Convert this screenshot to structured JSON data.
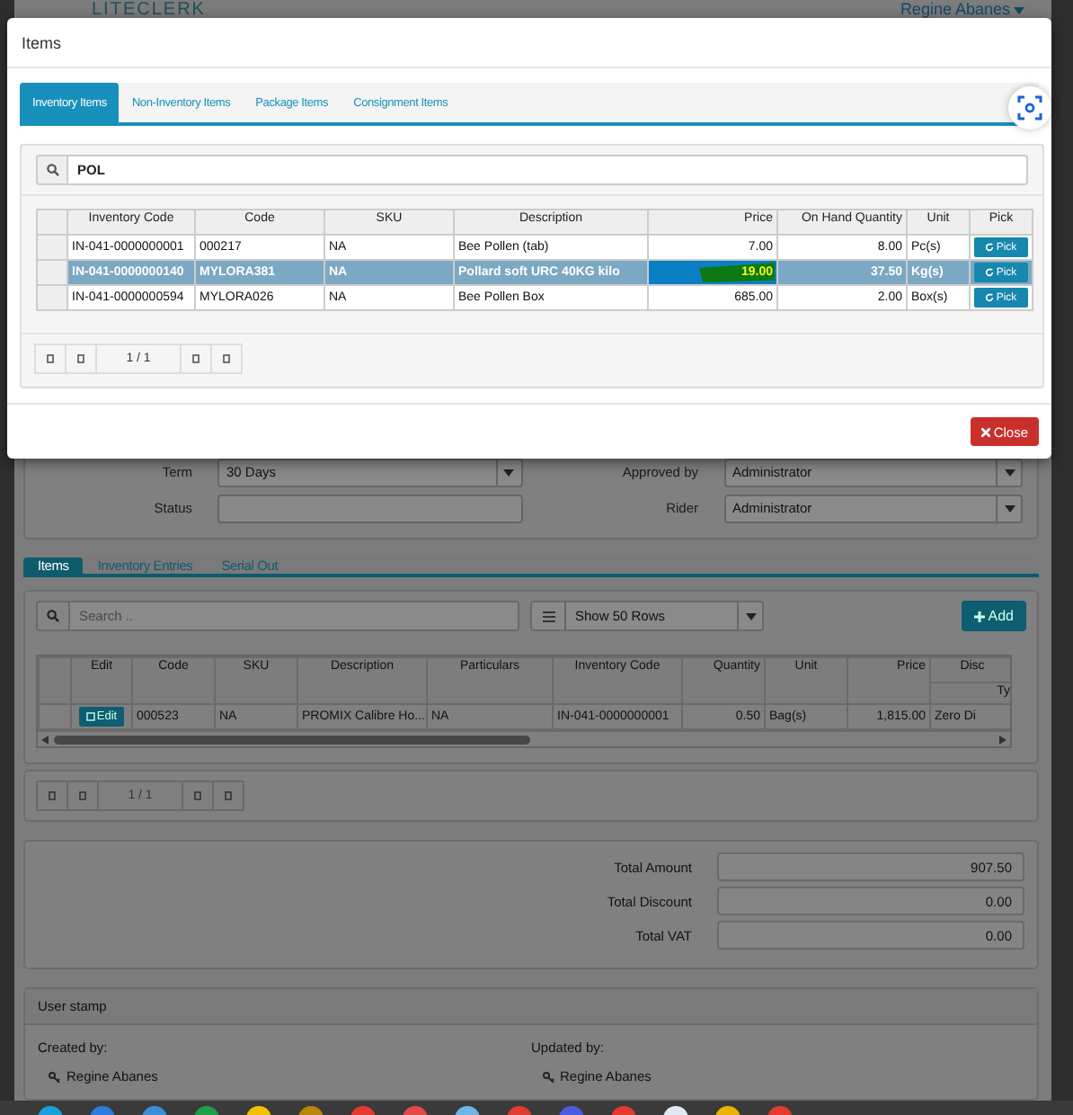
{
  "header": {
    "logo": "LITECLERK",
    "user": "Regine Abanes"
  },
  "form": {
    "fields": [
      {
        "label": "Term",
        "value": "30 Days",
        "kind": "select"
      },
      {
        "label": "Approved by",
        "value": "Administrator",
        "kind": "select"
      },
      {
        "label": "Status",
        "kind": "text"
      },
      {
        "label": "Rider",
        "value": "Administrator",
        "kind": "select"
      }
    ]
  },
  "tabs": [
    {
      "label": "Items",
      "selected": true
    },
    {
      "label": "Inventory Entries",
      "selected": false
    },
    {
      "label": "Serial Out",
      "selected": false
    }
  ],
  "toolbar": {
    "search": {
      "placeholder": "Search .."
    },
    "rows_select": "Show 50 Rows",
    "add_button": "Add"
  },
  "items_table": {
    "columns": [
      "Edit",
      "Code",
      "SKU",
      "Description",
      "Particulars",
      "Inventory Code",
      "Quantity",
      "Unit",
      "Price",
      "Disc"
    ],
    "subheader": "Ty",
    "rows": [
      {
        "cells": [
          "Edit",
          "000523",
          "NA",
          "PROMIX Calibre Ho...",
          "NA",
          "IN-041-0000000001",
          "0.50",
          "Bag(s)",
          "1,815.00",
          "Zero Di"
        ]
      }
    ]
  },
  "items_pager": {
    "page": "1 / 1"
  },
  "totals": [
    {
      "label": "Total Amount",
      "value": "907.50"
    },
    {
      "label": "Total Discount",
      "value": "0.00"
    },
    {
      "label": "Total VAT",
      "value": "0.00"
    }
  ],
  "user_stamp": {
    "title": "User stamp",
    "created_label": "Created by:",
    "created_by": "Regine Abanes",
    "updated_label": "Updated by:",
    "updated_by": "Regine Abanes"
  },
  "modal": {
    "title": "Items",
    "tabs": [
      {
        "label": "Inventory Items",
        "selected": true
      },
      {
        "label": "Non-Inventory Items",
        "selected": false
      },
      {
        "label": "Package Items",
        "selected": false
      },
      {
        "label": "Consignment Items",
        "selected": false
      }
    ],
    "search": {
      "value": "POL"
    },
    "table": {
      "columns": [
        "Inventory Code",
        "Code",
        "SKU",
        "Description",
        "Price",
        "On Hand Quantity",
        "Unit",
        "Pick"
      ],
      "rows": [
        {
          "selected": false,
          "marked": false,
          "cells": [
            "IN-041-0000000001",
            "000217",
            "NA",
            "Bee Pollen (tab)",
            "7.00",
            "8.00",
            "Pc(s)"
          ],
          "pick": "Pick"
        },
        {
          "selected": true,
          "marked": true,
          "cells": [
            "IN-041-0000000140",
            "MYLORA381",
            "NA",
            "Pollard soft URC 40KG kilo",
            "19.00",
            "37.50",
            "Kg(s)"
          ],
          "pick": "Pick"
        },
        {
          "selected": false,
          "marked": false,
          "cells": [
            "IN-041-0000000594",
            "MYLORA026",
            "NA",
            "Bee Pollen Box",
            "685.00",
            "2.00",
            "Box(s)"
          ],
          "pick": "Pick"
        }
      ]
    },
    "pager": {
      "page": "1 / 1"
    },
    "close_button": "Close"
  }
}
